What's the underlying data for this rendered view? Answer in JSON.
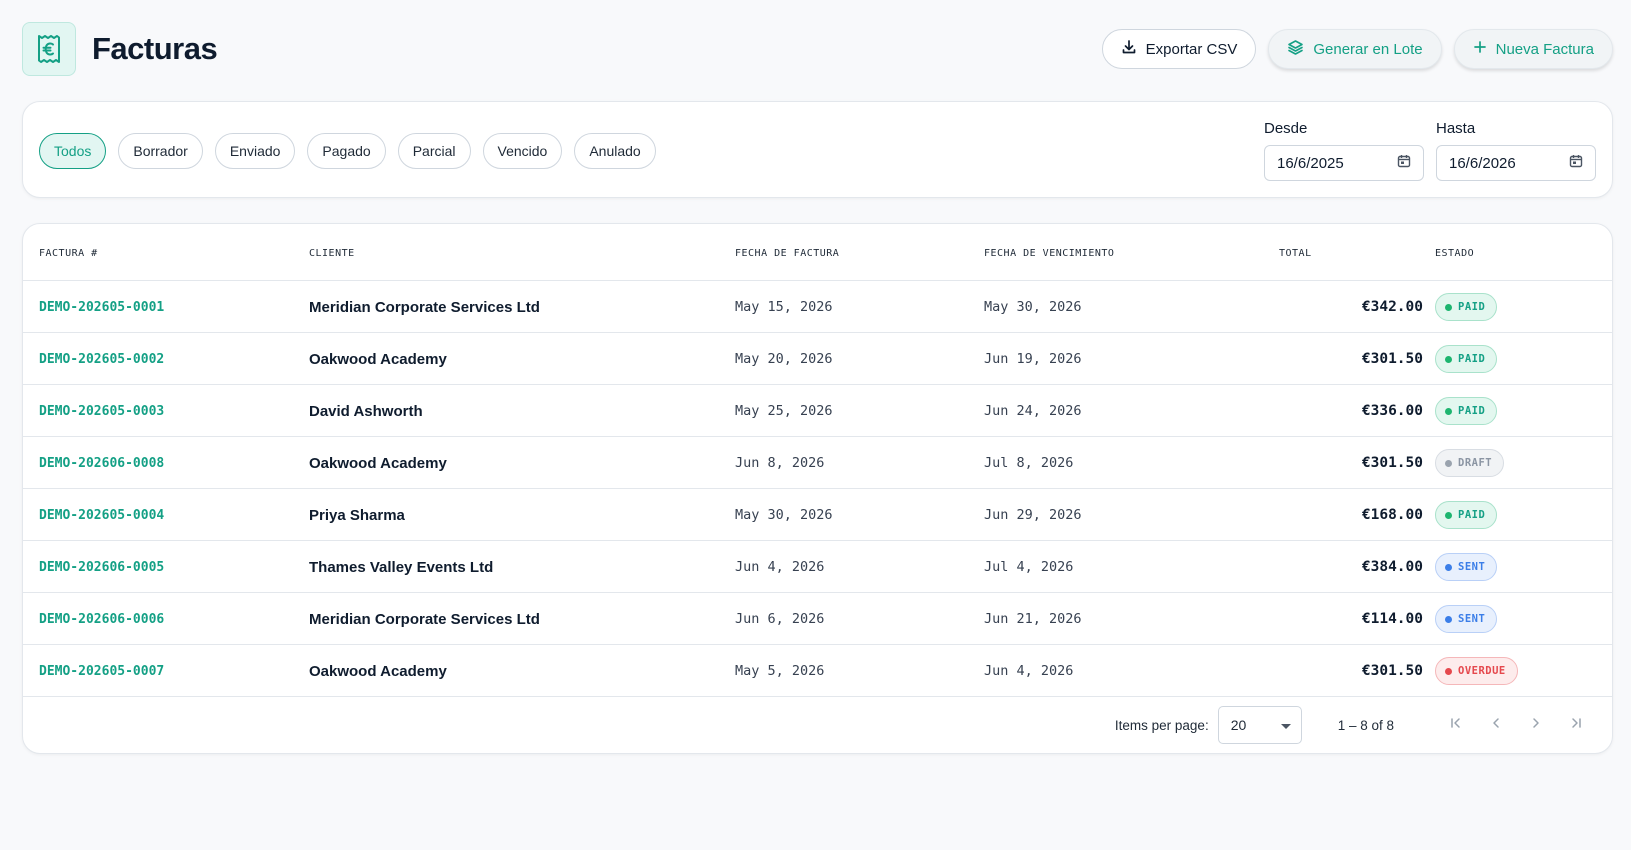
{
  "header": {
    "title": "Facturas",
    "logo_icon": "euro-receipt-icon",
    "export_label": "Exportar CSV",
    "batch_label": "Generar en Lote",
    "new_label": "Nueva Factura"
  },
  "filters": {
    "chips": [
      {
        "label": "Todos",
        "active": true
      },
      {
        "label": "Borrador",
        "active": false
      },
      {
        "label": "Enviado",
        "active": false
      },
      {
        "label": "Pagado",
        "active": false
      },
      {
        "label": "Parcial",
        "active": false
      },
      {
        "label": "Vencido",
        "active": false
      },
      {
        "label": "Anulado",
        "active": false
      }
    ],
    "from_label": "Desde",
    "from_value": "16/6/2025",
    "to_label": "Hasta",
    "to_value": "16/6/2026"
  },
  "table": {
    "columns": {
      "number": "FACTURA #",
      "client": "CLIENTE",
      "invoice_date": "FECHA DE FACTURA",
      "due_date": "FECHA DE VENCIMIENTO",
      "total": "TOTAL",
      "status": "ESTADO"
    },
    "rows": [
      {
        "number": "DEMO-202605-0001",
        "client": "Meridian Corporate Services Ltd",
        "invoice_date": "May 15, 2026",
        "due_date": "May 30, 2026",
        "total": "€342.00",
        "status": "PAID"
      },
      {
        "number": "DEMO-202605-0002",
        "client": "Oakwood Academy",
        "invoice_date": "May 20, 2026",
        "due_date": "Jun 19, 2026",
        "total": "€301.50",
        "status": "PAID"
      },
      {
        "number": "DEMO-202605-0003",
        "client": "David Ashworth",
        "invoice_date": "May 25, 2026",
        "due_date": "Jun 24, 2026",
        "total": "€336.00",
        "status": "PAID"
      },
      {
        "number": "DEMO-202606-0008",
        "client": "Oakwood Academy",
        "invoice_date": "Jun 8, 2026",
        "due_date": "Jul 8, 2026",
        "total": "€301.50",
        "status": "DRAFT"
      },
      {
        "number": "DEMO-202605-0004",
        "client": "Priya Sharma",
        "invoice_date": "May 30, 2026",
        "due_date": "Jun 29, 2026",
        "total": "€168.00",
        "status": "PAID"
      },
      {
        "number": "DEMO-202606-0005",
        "client": "Thames Valley Events Ltd",
        "invoice_date": "Jun 4, 2026",
        "due_date": "Jul 4, 2026",
        "total": "€384.00",
        "status": "SENT"
      },
      {
        "number": "DEMO-202606-0006",
        "client": "Meridian Corporate Services Ltd",
        "invoice_date": "Jun 6, 2026",
        "due_date": "Jun 21, 2026",
        "total": "€114.00",
        "status": "SENT"
      },
      {
        "number": "DEMO-202605-0007",
        "client": "Oakwood Academy",
        "invoice_date": "May 5, 2026",
        "due_date": "Jun 4, 2026",
        "total": "€301.50",
        "status": "OVERDUE"
      }
    ]
  },
  "status_colors": {
    "PAID": {
      "text": "#14a085",
      "bg": "#e3f7ef",
      "border": "#a9e2cb",
      "dot": "#1db56f"
    },
    "DRAFT": {
      "text": "#8b95a3",
      "bg": "#f1f3f5",
      "border": "#d8dde3",
      "dot": "#9aa3ae"
    },
    "SENT": {
      "text": "#3b7ee8",
      "bg": "#e8f0fd",
      "border": "#b9d0f7",
      "dot": "#3b7ee8"
    },
    "OVERDUE": {
      "text": "#e5484d",
      "bg": "#fdecec",
      "border": "#f5b7b9",
      "dot": "#e5484d"
    }
  },
  "pagination": {
    "items_label": "Items per page:",
    "per_page": "20",
    "range": "1 – 8 of 8"
  },
  "colors": {
    "accent": "#14a085",
    "accent_soft": "#e2f6f2",
    "page_bg": "#f8f9fb"
  }
}
